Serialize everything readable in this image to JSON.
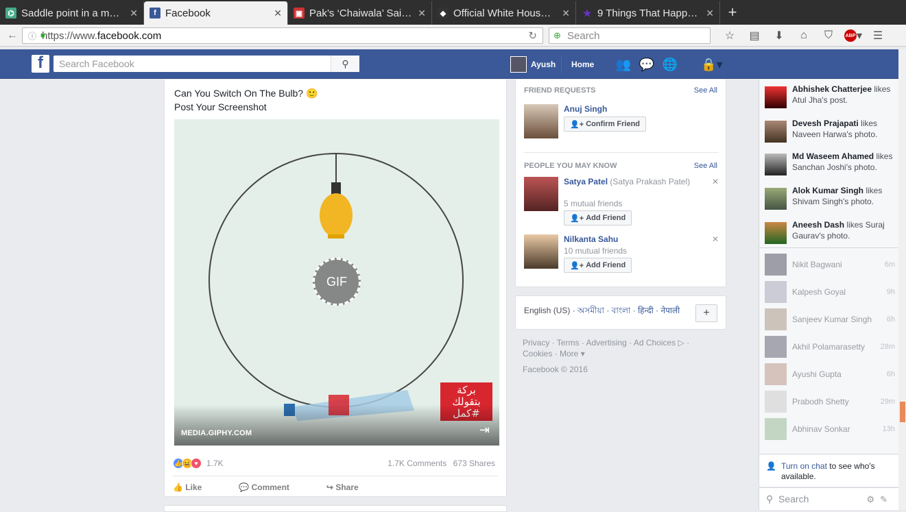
{
  "browser": {
    "tabs": [
      {
        "title": "Saddle point in a m…",
        "favicon": "xkcd-like-icon",
        "color": "#4a8"
      },
      {
        "title": "Facebook",
        "favicon": "facebook-icon",
        "color": "#3b5998",
        "active": true
      },
      {
        "title": "Pak’s ‘Chaiwala’ Sai…",
        "favicon": "news-icon",
        "color": "#c33"
      },
      {
        "title": "Official White Hous…",
        "favicon": "whitehouse-icon",
        "color": "#333"
      },
      {
        "title": "9 Things That Happ…",
        "favicon": "star-icon",
        "color": "#63c"
      }
    ],
    "url_prefix": "https://www.",
    "url_domain": "facebook.com",
    "search_placeholder": "Search"
  },
  "header": {
    "logo": "f",
    "search_placeholder": "Search Facebook",
    "profile_name": "Ayush",
    "home_label": "Home"
  },
  "post": {
    "text_line1": "Can You Switch On The Bulb? 🙂",
    "text_line2": "Post Your Screenshot",
    "gif_label": "GIF",
    "gif_source": "MEDIA.GIPHY.COM",
    "arabic_text": "بركة\nبتقولك\n#كمل",
    "reaction_count": "1.7K",
    "comments": "1.7K Comments",
    "shares": "673 Shares",
    "actions": {
      "like": "Like",
      "comment": "Comment",
      "share": "Share"
    }
  },
  "right": {
    "friend_requests_title": "FRIEND REQUESTS",
    "see_all": "See All",
    "request": {
      "name": "Anuj Singh",
      "confirm": "Confirm Friend"
    },
    "pymk_title": "PEOPLE YOU MAY KNOW",
    "pymk": [
      {
        "name": "Satya Patel",
        "alt": "(Satya Prakash Patel)",
        "mutual": "5 mutual friends",
        "button": "Add Friend"
      },
      {
        "name": "Nilkanta Sahu",
        "alt": "",
        "mutual": "10 mutual friends",
        "button": "Add Friend"
      }
    ],
    "language_current": "English (US)",
    "languages": "· অসমীয়া · বাংলা · हिन्दी · नेपाली",
    "footer_line1": "Privacy · Terms · Advertising · Ad Choices ▷ ·",
    "footer_line2": "Cookies · More ▾",
    "copyright": "Facebook © 2016"
  },
  "ticker": [
    {
      "name": "Abhishek Chatterjee",
      "action": " likes",
      "rest": "Atul Jha's post."
    },
    {
      "name": "Devesh Prajapati",
      "action": " likes",
      "rest": "Naveen Harwa's photo."
    },
    {
      "name": "Md Waseem Ahamed",
      "action": " likes",
      "rest": "Sanchan Joshi's photo."
    },
    {
      "name": "Alok Kumar Singh",
      "action": " likes",
      "rest": "Shivam Singh's photo."
    },
    {
      "name": "Aneesh Dash",
      "action": " likes Suraj",
      "rest": "Gaurav's photo."
    }
  ],
  "chat": [
    {
      "name": "Nikit Bagwani",
      "time": "6m"
    },
    {
      "name": "Kalpesh Goyal",
      "time": "9h"
    },
    {
      "name": "Sanjeev Kumar Singh",
      "time": "6h"
    },
    {
      "name": "Akhil Polamarasetty",
      "time": "28m"
    },
    {
      "name": "Ayushi Gupta",
      "time": "6h"
    },
    {
      "name": "Prabodh Shetty",
      "time": "29m"
    },
    {
      "name": "Abhinav Sonkar",
      "time": "13h"
    }
  ],
  "chat_off": {
    "link": "Turn on chat",
    "rest": " to see who's available."
  },
  "chat_search_placeholder": "Search"
}
